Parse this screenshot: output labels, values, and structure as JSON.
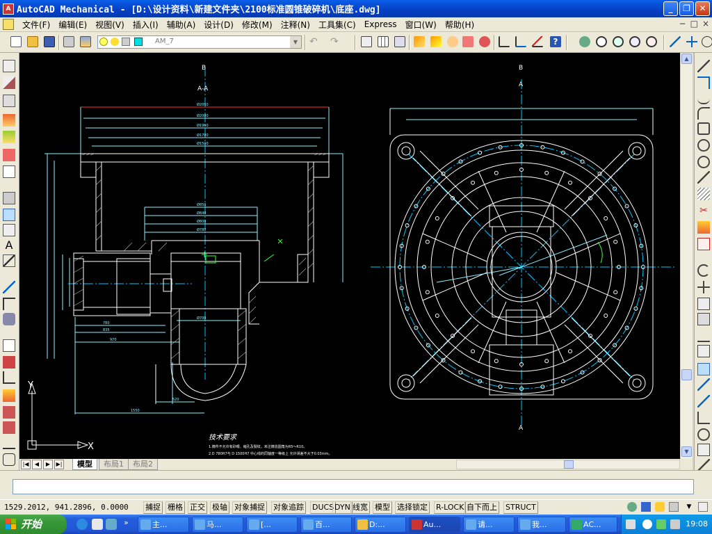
{
  "window": {
    "app_icon": "autocad-logo-icon",
    "title": "AutoCAD Mechanical - [D:\\设计资料\\新建文件夹\\2100标准圆锥破碎机\\底座.dwg]",
    "controls": [
      "minimize-icon",
      "restore-icon",
      "close-icon"
    ]
  },
  "menu": {
    "items": [
      "文件(F)",
      "编辑(E)",
      "视图(V)",
      "插入(I)",
      "辅助(A)",
      "设计(D)",
      "修改(M)",
      "注释(N)",
      "工具集(C)",
      "Express",
      "窗口(W)",
      "帮助(H)"
    ],
    "mdi": [
      "−",
      "□",
      "×"
    ]
  },
  "toolbar": {
    "layer_value": "AM_7"
  },
  "drawing": {
    "label_b_left": "B",
    "label_b_right": "B",
    "label_section": "A-A",
    "label_a_top": "A",
    "label_a_bottom": "A",
    "notes_title": "技术要求",
    "notes_line1": "1.铸件不允许有砂眼、缩孔及裂纹，未注铸造圆角为R5～R10。",
    "notes_line2": "2.D 780H7与 D 1500H7 中心线的同轴度一等级上 允许误差不大于0.03mm。",
    "ucs_x": "X",
    "ucs_y": "Y"
  },
  "layout_tabs": [
    "模型",
    "布局1",
    "布局2"
  ],
  "command_line": {
    "value": ""
  },
  "status": {
    "coords": "1529.2012, 941.2896, 0.0000",
    "toggles": [
      "捕捉",
      "栅格",
      "正交",
      "极轴",
      "对象捕捉",
      "对象追踪",
      "DUCS",
      "DYN",
      "线宽",
      "模型",
      "选择锁定",
      "R-LOCK",
      "自下而上",
      "STRUCT"
    ]
  },
  "taskbar": {
    "start_label": "开始",
    "buttons": [
      "主...",
      "马...",
      "[...",
      "百...",
      "D:...",
      "Au...",
      "请...",
      "我...",
      "AC..."
    ],
    "clock": "19:08"
  },
  "colors": {
    "titlebar": "#0643c9",
    "drawing_bg": "#000000",
    "geometry_white": "#ffffff",
    "centerline_cyan": "#00c8ff",
    "dimension_cyan": "#8cf0ff",
    "dimension_red": "#ff3030",
    "annotation_green": "#40ff40",
    "start_green": "#379737"
  }
}
